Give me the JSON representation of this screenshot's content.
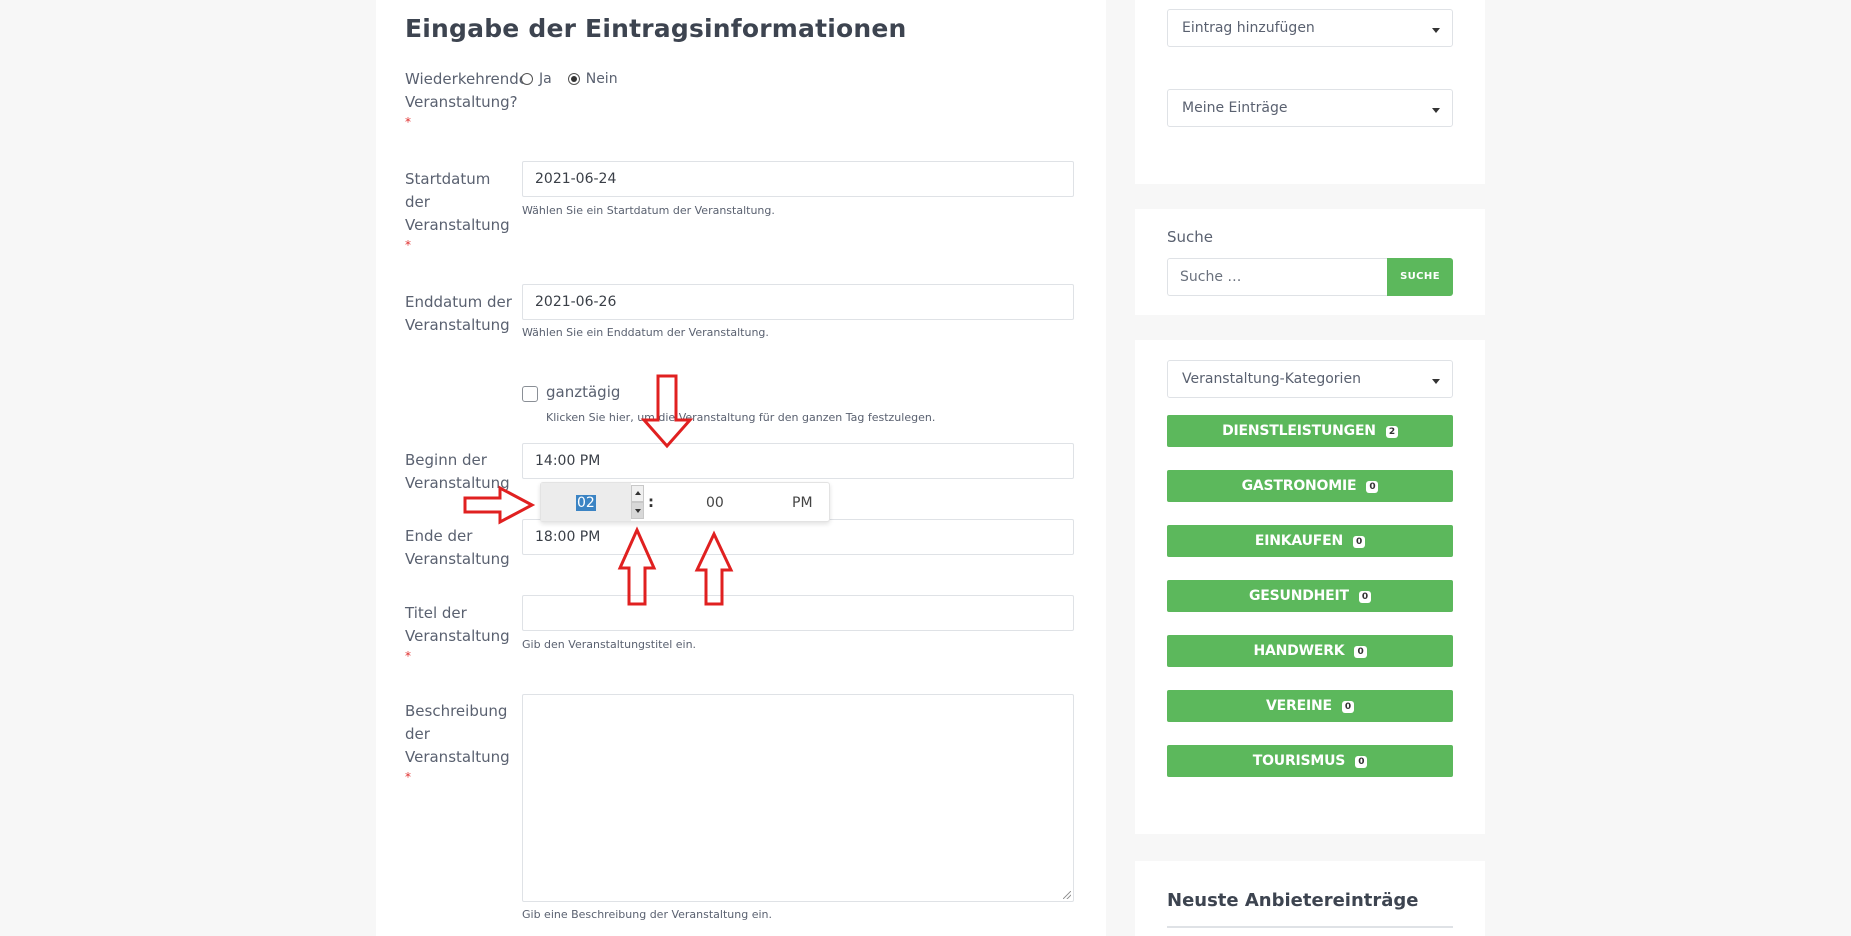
{
  "form": {
    "title": "Eingabe der Eintragsinformationen",
    "required_mark": "*",
    "recurring": {
      "label": "Wiederkehrende Veranstaltung?",
      "option_yes": "Ja",
      "option_no": "Nein",
      "selected": "Nein"
    },
    "start_date": {
      "label": "Startdatum der Veranstaltung",
      "value": "2021-06-24",
      "hint": "Wählen Sie ein Startdatum der Veranstaltung."
    },
    "end_date": {
      "label": "Enddatum der Veranstaltung",
      "value": "2021-06-26",
      "hint": "Wählen Sie ein Enddatum der Veranstaltung."
    },
    "all_day": {
      "label": "ganztägig",
      "hint": "Klicken Sie hier, um die Veranstaltung für den ganzen Tag festzulegen.",
      "checked": false
    },
    "start_time": {
      "label": "Beginn der Veranstaltung",
      "value": "14:00 PM"
    },
    "end_time": {
      "label": "Ende der Veranstaltung",
      "value": "18:00 PM"
    },
    "title_field": {
      "label": "Titel der Veranstaltung",
      "value": "",
      "hint": "Gib den Veranstaltungstitel ein."
    },
    "description": {
      "label": "Beschreibung der Veranstaltung",
      "value": "",
      "hint": "Gib eine Beschreibung der Veranstaltung ein."
    }
  },
  "timepicker": {
    "hour": "02",
    "separator": ":",
    "minute": "00",
    "ampm": "PM"
  },
  "sidebar": {
    "add_entry": "Eintrag hinzufügen",
    "my_entries": "Meine Einträge",
    "search_label": "Suche",
    "search_placeholder": "Suche …",
    "search_button": "SUCHE",
    "category_select": "Veranstaltung-Kategorien",
    "categories": [
      {
        "name": "DIENSTLEISTUNGEN",
        "count": "2"
      },
      {
        "name": "GASTRONOMIE",
        "count": "0"
      },
      {
        "name": "EINKAUFEN",
        "count": "0"
      },
      {
        "name": "GESUNDHEIT",
        "count": "0"
      },
      {
        "name": "HANDWERK",
        "count": "0"
      },
      {
        "name": "VEREINE",
        "count": "0"
      },
      {
        "name": "TOURISMUS",
        "count": "0"
      }
    ],
    "newest_title": "Neuste Anbietereinträge"
  },
  "colors": {
    "accent_green": "#5cb85c",
    "required_red": "#e0302f",
    "annotation_red": "#e02020",
    "selection_blue": "#3b84c4"
  }
}
